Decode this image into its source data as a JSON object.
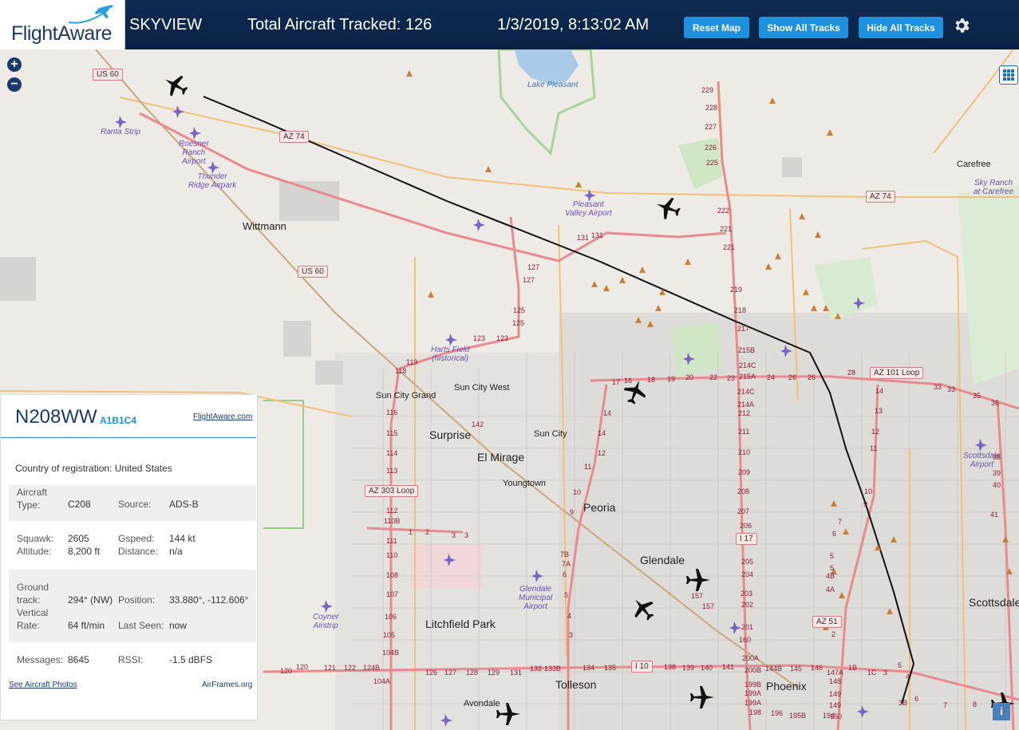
{
  "header": {
    "logo": "FlightAware",
    "title": "SKYVIEW",
    "tracked_label": "Total Aircraft Tracked: 126",
    "datetime": "1/3/2019, 8:13:02 AM",
    "reset_label": "Reset Map",
    "show_label": "Show All Tracks",
    "hide_label": "Hide All Tracks",
    "accent": "#1e90e0",
    "bar_color": "#0f2b52"
  },
  "map": {
    "zoom_in": "+",
    "zoom_out": "−",
    "cities": {
      "wittmann": "Wittmann",
      "sun_city_grand": "Sun City Grand",
      "sun_city_west": "Sun City West",
      "surprise": "Surprise",
      "sun_city": "Sun City",
      "el_mirage": "El Mirage",
      "youngtown": "Youngtown",
      "peoria": "Peoria",
      "glendale": "Glendale",
      "litchfield_park": "Litchfield Park",
      "tolleson": "Tolleson",
      "avondale": "Avondale",
      "phoenix": "Phoenix",
      "carefree": "Carefree",
      "scottsdale": "Scottsdale"
    },
    "water": {
      "lake_pleasant": "Lake Pleasant"
    },
    "airports": {
      "ranta": "Ranta Strip",
      "roesner_1": "Roesner",
      "roesner_2": "Ranch",
      "roesner_3": "Airport",
      "thunder_1": "Thunder",
      "thunder_2": "Ridge Airpark",
      "pleasant_valley_1": "Pleasant",
      "pleasant_valley_2": "Valley Airport",
      "harts_1": "Harts Field",
      "harts_2": "(historical)",
      "sky_ranch_1": "Sky Ranch",
      "sky_ranch_2": "at Carefree",
      "glendale_1": "Glendale",
      "glendale_2": "Municipal",
      "glendale_3": "Airport",
      "coyner_1": "Coyner",
      "coyner_2": "Airstrip",
      "scottsdale_1": "Scottsdale",
      "scottsdale_2": "Airport"
    },
    "shields": {
      "us60_a": "US 60",
      "az74_a": "AZ 74",
      "us60_b": "US 60",
      "az74_b": "AZ 74",
      "az101": "AZ 101 Loop",
      "az303": "AZ 303 Loop",
      "i17": "I 17",
      "az51": "AZ 51",
      "i10": "I 10"
    },
    "exits": {
      "e229": "229",
      "e228": "228",
      "e227": "227",
      "e226": "226",
      "e225": "225",
      "e222": "222",
      "e221a": "221",
      "e221b": "221",
      "e219": "219",
      "e218": "218",
      "e217": "217",
      "e215b": "215B",
      "e214c": "214C",
      "e215a": "215A",
      "e214c2": "214C",
      "e214a": "214A",
      "e212": "212",
      "e211": "211",
      "e210": "210",
      "e209": "209",
      "e208": "208",
      "e207": "207",
      "e206": "206",
      "e205": "205",
      "e204": "204",
      "e203": "203",
      "e202": "202",
      "e201": "201",
      "e131a": "131",
      "e131b": "131",
      "e127a": "127",
      "e127b": "127",
      "e125a": "125",
      "e125b": "125",
      "e123a": "123",
      "e123b": "123",
      "e119": "119",
      "e118": "118",
      "e116": "116",
      "e115": "115",
      "e114": "114",
      "e113": "113",
      "e112": "112",
      "e110b": "110B",
      "e111": "111",
      "e110": "110",
      "e108": "108",
      "e107": "107",
      "e106": "106",
      "e105": "105",
      "e104b": "104B",
      "e104a": "104A",
      "e142": "142",
      "e16": "16",
      "e18": "18",
      "e19": "19",
      "e20": "20",
      "e22": "22",
      "e23": "23",
      "e24": "24",
      "e26a": "26",
      "e26b": "26",
      "e28": "28",
      "e33a": "33",
      "e33b": "33",
      "e35": "35",
      "e36": "36",
      "e14a": "14",
      "e14b": "14",
      "e13": "13",
      "e12": "12",
      "e11": "11",
      "e10": "10",
      "e9": "9",
      "e7b": "7B",
      "e7a": "7A",
      "e6": "6",
      "e5": "5",
      "e4": "4",
      "e3": "3",
      "e157a": "157",
      "e157b": "157",
      "e160": "160",
      "e200a": "200A",
      "e200b": "200B",
      "e199b": "199B",
      "e199a": "199A",
      "e198": "198",
      "e196": "196",
      "e195b": "195B",
      "e194": "194",
      "e120": "120",
      "e121": "121",
      "e122": "122",
      "e124b": "124B",
      "e126": "126",
      "e127": "127",
      "e128": "128",
      "e129": "129",
      "e131": "131",
      "e132": "132",
      "e133b": "133B",
      "e134": "134",
      "e135": "135",
      "e138": "138",
      "e139": "139",
      "e140": "140",
      "e141": "141",
      "e144b": "144B",
      "e145": "145",
      "e146": "146",
      "e147a": "147A",
      "e148": "148",
      "e149a": "149",
      "e149b": "149",
      "e150": "150",
      "e1b": "1B",
      "e1c": "1C",
      "e4b": "4B",
      "e4a": "4A",
      "e2": "2",
      "e15": "15",
      "e17": "17",
      "e1": "1",
      "e2b": "2",
      "e3b": "3",
      "e1c2": "1",
      "e38": "38",
      "e39": "39",
      "e40": "40",
      "e41": "41",
      "e3b2": "3B",
      "e6b": "6",
      "e7": "7",
      "e8": "8"
    }
  },
  "aircraft_panel": {
    "registration": "N208WW",
    "hex": "A1B1C4",
    "fa_link": "FlightAware.com",
    "country_label": "Country of registration:",
    "country_value": "United States",
    "aircraft_type_label": "Aircraft Type:",
    "aircraft_type_value": "C208",
    "source_label": "Source:",
    "source_value": "ADS-B",
    "squawk_label": "Squawk:",
    "squawk_value": "2605",
    "gspeed_label": "Gspeed:",
    "gspeed_value": "144 kt",
    "altitude_label": "Altitude:",
    "altitude_value": "8,200 ft",
    "distance_label": "Distance:",
    "distance_value": "n/a",
    "ground_track_label": "Ground track:",
    "ground_track_value": "294° (NW)",
    "position_label": "Position:",
    "position_value": "33.880°, -112.606°",
    "vertical_rate_label": "Vertical Rate:",
    "vertical_rate_value": "64 ft/min",
    "last_seen_label": "Last Seen:",
    "last_seen_value": "now",
    "messages_label": "Messages:",
    "messages_value": "8645",
    "rssi_label": "RSSI:",
    "rssi_value": "-1.5 dBFS",
    "photos_link": "See Aircraft Photos",
    "airframes_link": "AirFrames.org"
  }
}
